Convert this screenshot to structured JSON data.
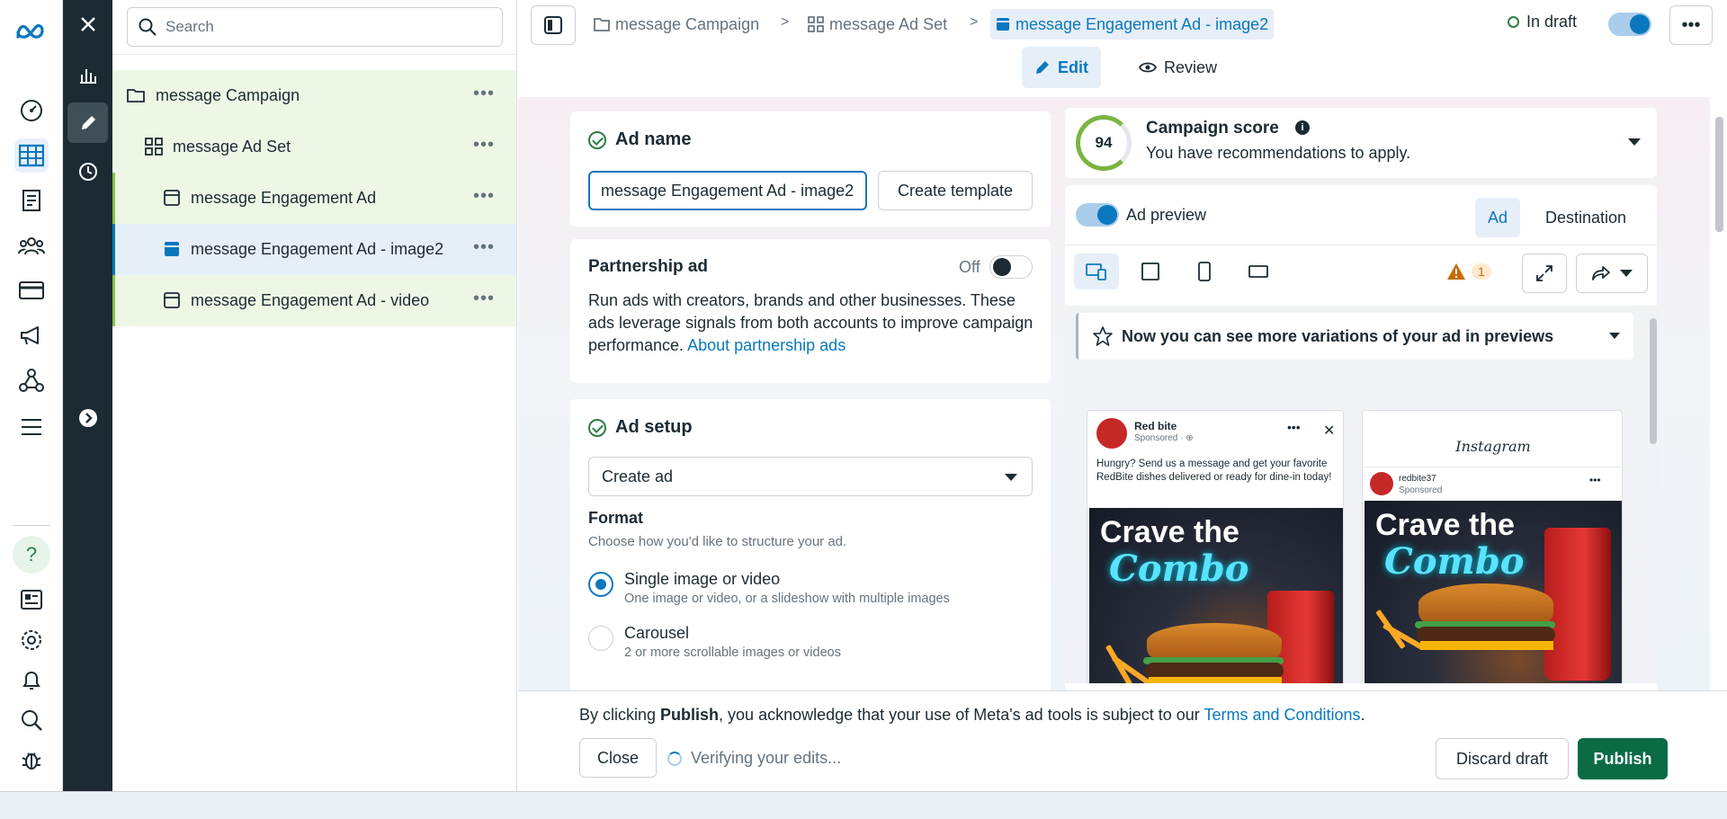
{
  "app": {
    "logo": "meta-logo"
  },
  "rail": {
    "icons": [
      "dashboard-icon",
      "table-icon",
      "catalog-icon",
      "audience-icon",
      "billing-icon",
      "campaign-megaphone-icon",
      "network-icon",
      "menu-icon",
      "help-icon",
      "page-icon",
      "gear-icon",
      "bell-icon",
      "search-icon",
      "bug-icon"
    ]
  },
  "tools": {
    "icons": [
      "close-icon",
      "chart-icon",
      "pencil-icon",
      "history-icon",
      "expand-arrow-icon"
    ]
  },
  "search": {
    "placeholder": "Search"
  },
  "tree": {
    "items": [
      {
        "label": "message Campaign",
        "type": "campaign"
      },
      {
        "label": "message Ad Set",
        "type": "adset"
      },
      {
        "label": "message Engagement Ad",
        "type": "ad"
      },
      {
        "label": "message Engagement Ad - image2",
        "type": "ad",
        "selected": true
      },
      {
        "label": "message Engagement Ad - video",
        "type": "ad"
      }
    ],
    "more": "•••"
  },
  "breadcrumb": {
    "campaign": "message Campaign",
    "adset": "message Ad Set",
    "ad": "message Engagement Ad - image2",
    "sep": ">"
  },
  "status": {
    "label": "In draft"
  },
  "modes": {
    "edit": "Edit",
    "review": "Review"
  },
  "kebab": "•••",
  "ad_name": {
    "heading": "Ad name",
    "value": "message Engagement Ad - image2",
    "template_button": "Create template"
  },
  "partnership": {
    "heading": "Partnership ad",
    "toggle_label": "Off",
    "description": "Run ads with creators, brands and other businesses. These ads leverage signals from both accounts to improve campaign performance.",
    "link": "About partnership ads"
  },
  "ad_setup": {
    "heading": "Ad setup",
    "select_value": "Create ad",
    "format_heading": "Format",
    "format_desc": "Choose how you'd like to structure your ad.",
    "options": [
      {
        "label": "Single image or video",
        "desc": "One image or video, or a slideshow with multiple images",
        "selected": true
      },
      {
        "label": "Carousel",
        "desc": "2 or more scrollable images or videos",
        "selected": false
      }
    ]
  },
  "score": {
    "value": "94",
    "title": "Campaign score",
    "subtitle": "You have recommendations to apply."
  },
  "preview": {
    "toggle_label": "Ad preview",
    "tabs": [
      "Ad",
      "Destination"
    ],
    "warning_count": "1",
    "notice": "Now you can see more variations of your ad in previews",
    "fb": {
      "page": "Red bite",
      "sponsored": "Sponsored · ⊕",
      "text": "Hungry? Send us a message and get your favorite RedBite dishes delivered or ready for dine-in today!",
      "more": "•••",
      "close": "✕"
    },
    "ig": {
      "brand": "Instagram",
      "account": "redbite37",
      "sponsored": "Sponsored",
      "more": "•••"
    },
    "creative": {
      "line1": "Crave the",
      "line2": "Combo"
    }
  },
  "footer": {
    "notice_pre": "By clicking ",
    "notice_bold": "Publish",
    "notice_mid": ", you acknowledge that your use of Meta's ad tools is subject to our ",
    "notice_link": "Terms and Conditions",
    "notice_end": ".",
    "close": "Close",
    "verifying": "Verifying your edits...",
    "discard": "Discard draft",
    "publish": "Publish"
  },
  "colors": {
    "accent": "#0a78be",
    "publish": "#0a6b45",
    "sidebar_dark": "#1c2b33",
    "tree_highlight": "#eef7e5"
  }
}
